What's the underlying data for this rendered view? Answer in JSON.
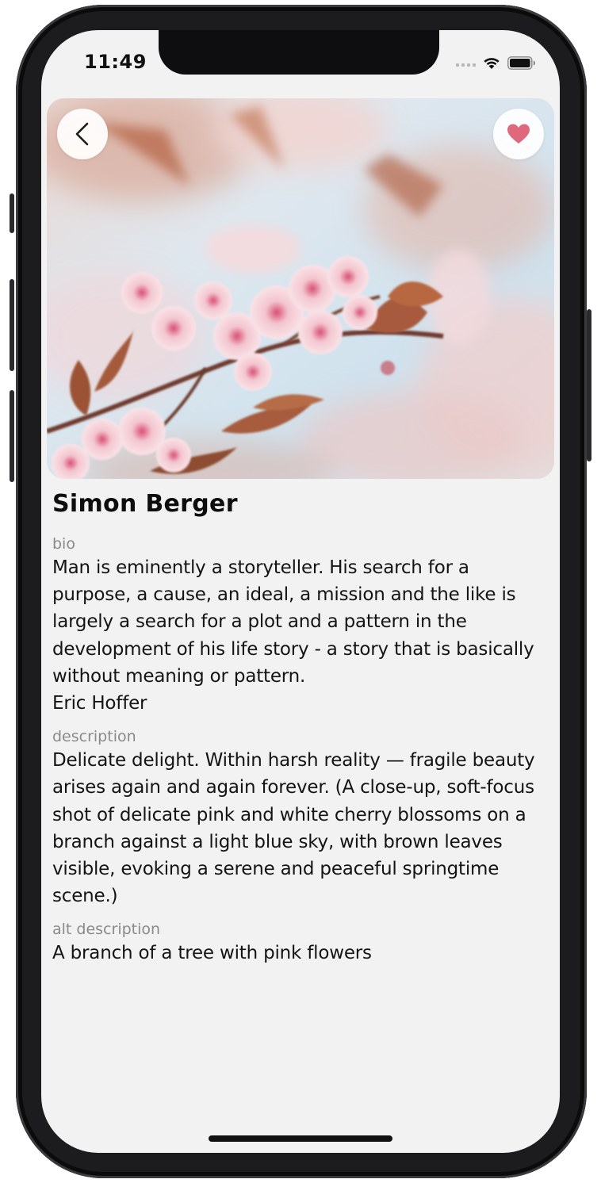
{
  "status_bar": {
    "time": "11:49"
  },
  "photo": {
    "alt": "A branch of a tree with pink flowers",
    "back_icon": "chevron-left-icon",
    "like_icon": "heart-icon",
    "like_color": "#e0687c"
  },
  "profile": {
    "name": "Simon Berger",
    "bio_label": "bio",
    "bio_text": "Man is eminently a storyteller. His search for a purpose, a cause, an ideal, a mission and the like is largely a search for a plot and a pattern in the development of his life story - a story that is basically without meaning or pattern.\nEric Hoffer",
    "description_label": "description",
    "description_text": "Delicate delight. Within harsh reality — fragile beauty arises again and again forever. (A close-up, soft-focus shot of delicate pink and white cherry blossoms on a branch against a light blue sky, with brown leaves visible, evoking a serene and peaceful springtime scene.)",
    "alt_label": "alt description",
    "alt_text": "A branch of a tree with pink flowers"
  }
}
